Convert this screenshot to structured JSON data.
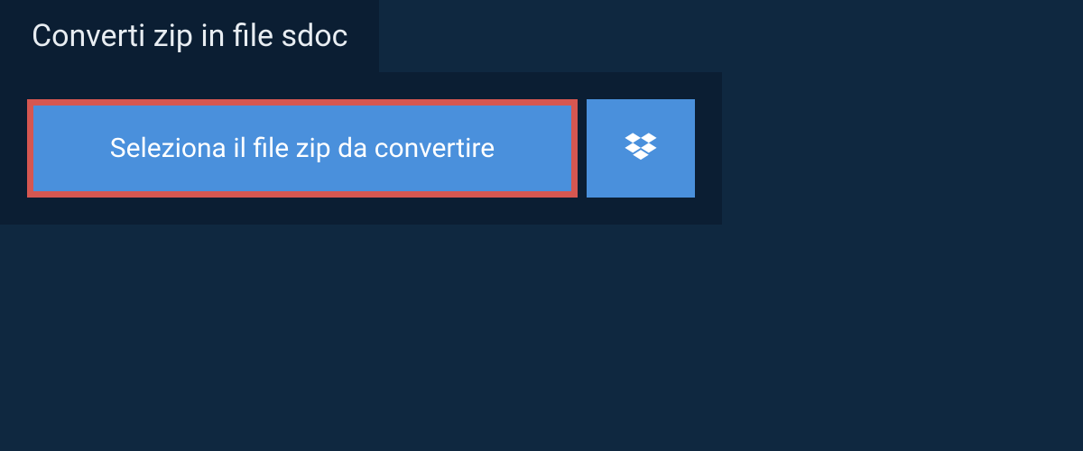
{
  "tab": {
    "title": "Converti zip in file sdoc"
  },
  "actions": {
    "select_file_label": "Seleziona il file zip da convertire"
  },
  "colors": {
    "background": "#0f2840",
    "panel": "#0b1e33",
    "button": "#4a90dc",
    "highlight_border": "#d65751",
    "text": "#ffffff"
  }
}
